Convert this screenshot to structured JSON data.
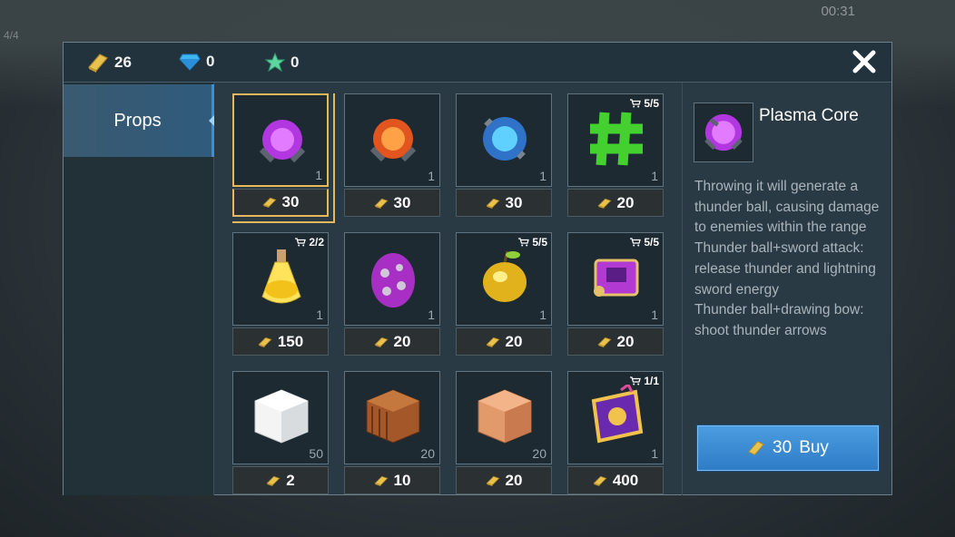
{
  "header": {
    "gold_count": "26",
    "diamond_count": "0",
    "star_count": "0"
  },
  "background": {
    "timer": "00:31",
    "counter": "4/4"
  },
  "sidebar": {
    "tabs": [
      {
        "label": "Props",
        "active": true
      }
    ]
  },
  "items": [
    {
      "name": "Plasma Core",
      "art": "purple-core-icon",
      "qty": "1",
      "price": "30",
      "limit": "",
      "selected": true
    },
    {
      "name": "Fire Core",
      "art": "orange-core-icon",
      "qty": "1",
      "price": "30",
      "limit": ""
    },
    {
      "name": "Ice Core",
      "art": "blue-core-icon",
      "qty": "1",
      "price": "30",
      "limit": ""
    },
    {
      "name": "Green Grid",
      "art": "green-hash-icon",
      "qty": "1",
      "price": "20",
      "limit": "5/5"
    },
    {
      "name": "Potion",
      "art": "yellow-potion-icon",
      "qty": "1",
      "price": "150",
      "limit": "2/2"
    },
    {
      "name": "Egg",
      "art": "purple-egg-icon",
      "qty": "1",
      "price": "20",
      "limit": ""
    },
    {
      "name": "Golden Apple",
      "art": "golden-apple-icon",
      "qty": "1",
      "price": "20",
      "limit": "5/5"
    },
    {
      "name": "Scroll",
      "art": "purple-scroll-icon",
      "qty": "1",
      "price": "20",
      "limit": "5/5"
    },
    {
      "name": "White Block",
      "art": "white-block-icon",
      "qty": "50",
      "price": "2",
      "limit": ""
    },
    {
      "name": "Wood Crate",
      "art": "wood-crate-icon",
      "qty": "20",
      "price": "10",
      "limit": ""
    },
    {
      "name": "Copper Block",
      "art": "copper-block-icon",
      "qty": "20",
      "price": "20",
      "limit": ""
    },
    {
      "name": "Spell Book",
      "art": "spell-book-icon",
      "qty": "1",
      "price": "400",
      "limit": "1/1"
    }
  ],
  "detail": {
    "name": "Plasma Core",
    "description": "Throwing it will generate a thunder ball, causing damage to enemies within the range\nThunder ball+sword attack: release thunder and lightning sword energy\nThunder ball+drawing bow: shoot thunder arrows",
    "buy_price": "30",
    "buy_label": "Buy"
  },
  "colors": {
    "selected_border": "#e7b85a",
    "buy_button": "#3a8cd6",
    "panel_bg": "#2a3a45"
  }
}
